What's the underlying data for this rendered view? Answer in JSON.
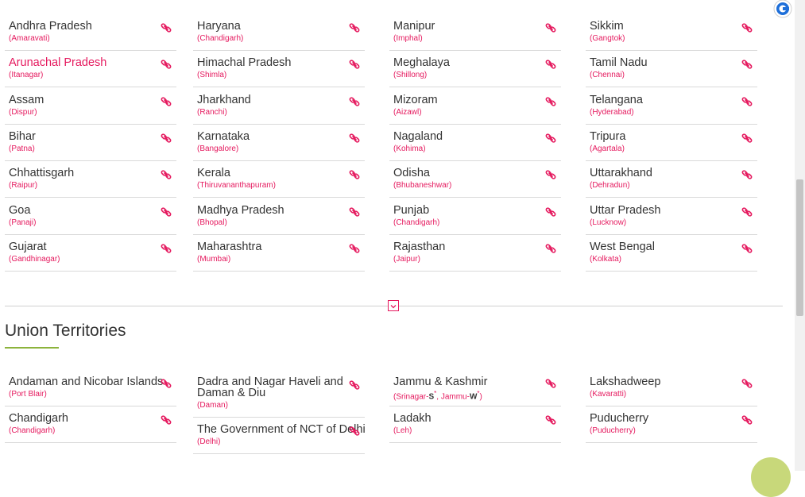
{
  "states": {
    "columns": [
      [
        {
          "name": "Andhra Pradesh",
          "capital": "(Amaravati)"
        },
        {
          "name": "Arunachal Pradesh",
          "capital": "(Itanagar)",
          "active": true
        },
        {
          "name": "Assam",
          "capital": "(Dispur)"
        },
        {
          "name": "Bihar",
          "capital": "(Patna)"
        },
        {
          "name": "Chhattisgarh",
          "capital": "(Raipur)"
        },
        {
          "name": "Goa",
          "capital": "(Panaji)"
        },
        {
          "name": "Gujarat",
          "capital": "(Gandhinagar)"
        }
      ],
      [
        {
          "name": "Haryana",
          "capital": "(Chandigarh)"
        },
        {
          "name": "Himachal Pradesh",
          "capital": "(Shimla)"
        },
        {
          "name": "Jharkhand",
          "capital": "(Ranchi)"
        },
        {
          "name": "Karnataka",
          "capital": "(Bangalore)"
        },
        {
          "name": "Kerala",
          "capital": "(Thiruvananthapuram)"
        },
        {
          "name": "Madhya Pradesh",
          "capital": "(Bhopal)"
        },
        {
          "name": "Maharashtra",
          "capital": "(Mumbai)"
        }
      ],
      [
        {
          "name": "Manipur",
          "capital": "(Imphal)"
        },
        {
          "name": "Meghalaya",
          "capital": "(Shillong)"
        },
        {
          "name": "Mizoram",
          "capital": "(Aizawl)"
        },
        {
          "name": "Nagaland",
          "capital": "(Kohima)"
        },
        {
          "name": "Odisha",
          "capital": "(Bhubaneshwar)"
        },
        {
          "name": "Punjab",
          "capital": "(Chandigarh)"
        },
        {
          "name": "Rajasthan",
          "capital": "(Jaipur)"
        }
      ],
      [
        {
          "name": "Sikkim",
          "capital": "(Gangtok)"
        },
        {
          "name": "Tamil Nadu",
          "capital": "(Chennai)"
        },
        {
          "name": "Telangana",
          "capital": "(Hyderabad)"
        },
        {
          "name": "Tripura",
          "capital": "(Agartala)"
        },
        {
          "name": "Uttarakhand",
          "capital": "(Dehradun)"
        },
        {
          "name": "Uttar Pradesh",
          "capital": "(Lucknow)"
        },
        {
          "name": "West Bengal",
          "capital": "(Kolkata)"
        }
      ]
    ]
  },
  "union_territories": {
    "title": "Union Territories",
    "columns": [
      [
        {
          "name": "Andaman and Nicobar Islands",
          "capital": "(Port Blair)"
        },
        {
          "name": "Chandigarh",
          "capital": "(Chandigarh)"
        }
      ],
      [
        {
          "name": "Dadra and Nagar Haveli and",
          "name2": "Daman & Diu",
          "capital": "(Daman)"
        },
        {
          "name": "The Government of NCT of Delhi",
          "capital": "(Delhi)"
        }
      ],
      [
        {
          "name": "Jammu & Kashmir",
          "capital_parts": [
            "(Srinagar-",
            "S",
            "*",
            ", Jammu-",
            "W",
            "*",
            ")"
          ]
        },
        {
          "name": "Ladakh",
          "capital": "(Leh)"
        }
      ],
      [
        {
          "name": "Lakshadweep",
          "capital": "(Kavaratti)"
        },
        {
          "name": "Puducherry",
          "capital": "(Puducherry)"
        }
      ]
    ]
  },
  "colors": {
    "accent": "#e5195e",
    "underline": "#8cb33c",
    "fab": "#c8d87a"
  },
  "icons": {
    "item_link": "link-icon",
    "expand": "chevron-down-icon",
    "extension": "browser-extension-icon"
  }
}
